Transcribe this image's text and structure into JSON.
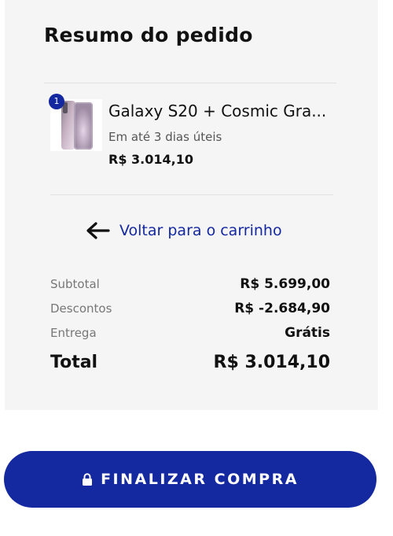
{
  "summary": {
    "title": "Resumo do pedido"
  },
  "item": {
    "quantity": "1",
    "name": "Galaxy S20 + Cosmic Gra...",
    "delivery": "Em até 3 dias úteis",
    "price": "R$ 3.014,10",
    "image_icon": "phone-product-image"
  },
  "back_link": {
    "icon": "arrow-left-icon",
    "label": "Voltar para o carrinho"
  },
  "totals": {
    "subtotal_label": "Subtotal",
    "subtotal_value": "R$ 5.699,00",
    "discount_label": "Descontos",
    "discount_value": "R$ -2.684,90",
    "shipping_label": "Entrega",
    "shipping_value": "Grátis",
    "total_label": "Total",
    "total_value": "R$ 3.014,10"
  },
  "checkout": {
    "icon": "lock-icon",
    "label": "FINALIZAR COMPRA"
  },
  "colors": {
    "brand_blue": "#1428a0",
    "panel_bg": "#f5f5f5"
  }
}
